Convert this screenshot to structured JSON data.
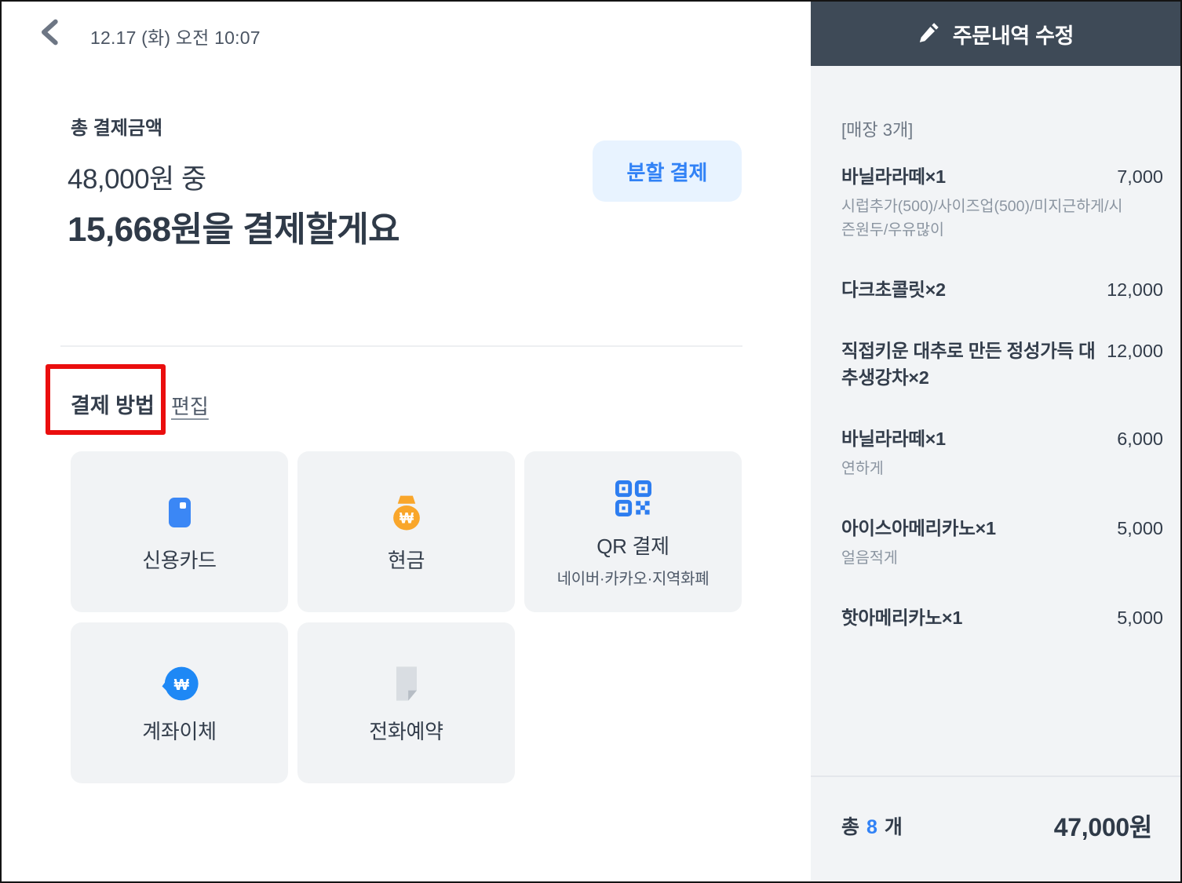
{
  "left": {
    "datetime": "12.17 (화) 오전 10:07",
    "total_label": "총 결제금액",
    "amount_total": "48,000원 중",
    "amount_due": "15,668원을 결제할게요",
    "split_button": "분할 결제",
    "section_title": "결제 방법",
    "edit_link": "편집",
    "methods": [
      {
        "label": "신용카드",
        "icon": "credit-card-icon"
      },
      {
        "label": "현금",
        "icon": "money-bag-icon"
      },
      {
        "label": "QR 결제",
        "subtitle": "네이버·카카오·지역화폐",
        "icon": "qr-code-icon"
      },
      {
        "label": "계좌이체",
        "icon": "bank-transfer-icon"
      },
      {
        "label": "전화예약",
        "icon": "document-icon"
      }
    ]
  },
  "order": {
    "header_title": "주문내역 수정",
    "group_label": "[매장 3개]",
    "items": [
      {
        "name": "바닐라라떼×1",
        "price": "7,000",
        "options": "시럽추가(500)/사이즈업(500)/미지근하게/시즌원두/우유많이"
      },
      {
        "name": "다크초콜릿×2",
        "price": "12,000"
      },
      {
        "name": "직접키운 대추로 만든 정성가득 대추생강차×2",
        "price": "12,000"
      },
      {
        "name": "바닐라라떼×1",
        "price": "6,000",
        "options": "연하게"
      },
      {
        "name": "아이스아메리카노×1",
        "price": "5,000",
        "options": "얼음적게"
      },
      {
        "name": "핫아메리카노×1",
        "price": "5,000"
      }
    ],
    "total_prefix": "총",
    "total_count": "8",
    "total_suffix": "개",
    "total_price": "47,000원"
  },
  "colors": {
    "accent_blue": "#3182f6",
    "split_button_bg": "#e8f3ff",
    "header_bg": "#3e4a57",
    "panel_bg": "#f2f4f6",
    "card_bg": "#f1f3f5",
    "annotation_red": "#ea0e0e",
    "text_dark": "#333d4b",
    "text_gray": "#8b95a1",
    "cash_orange": "#f9a62b",
    "transfer_blue": "#1e88f5"
  }
}
